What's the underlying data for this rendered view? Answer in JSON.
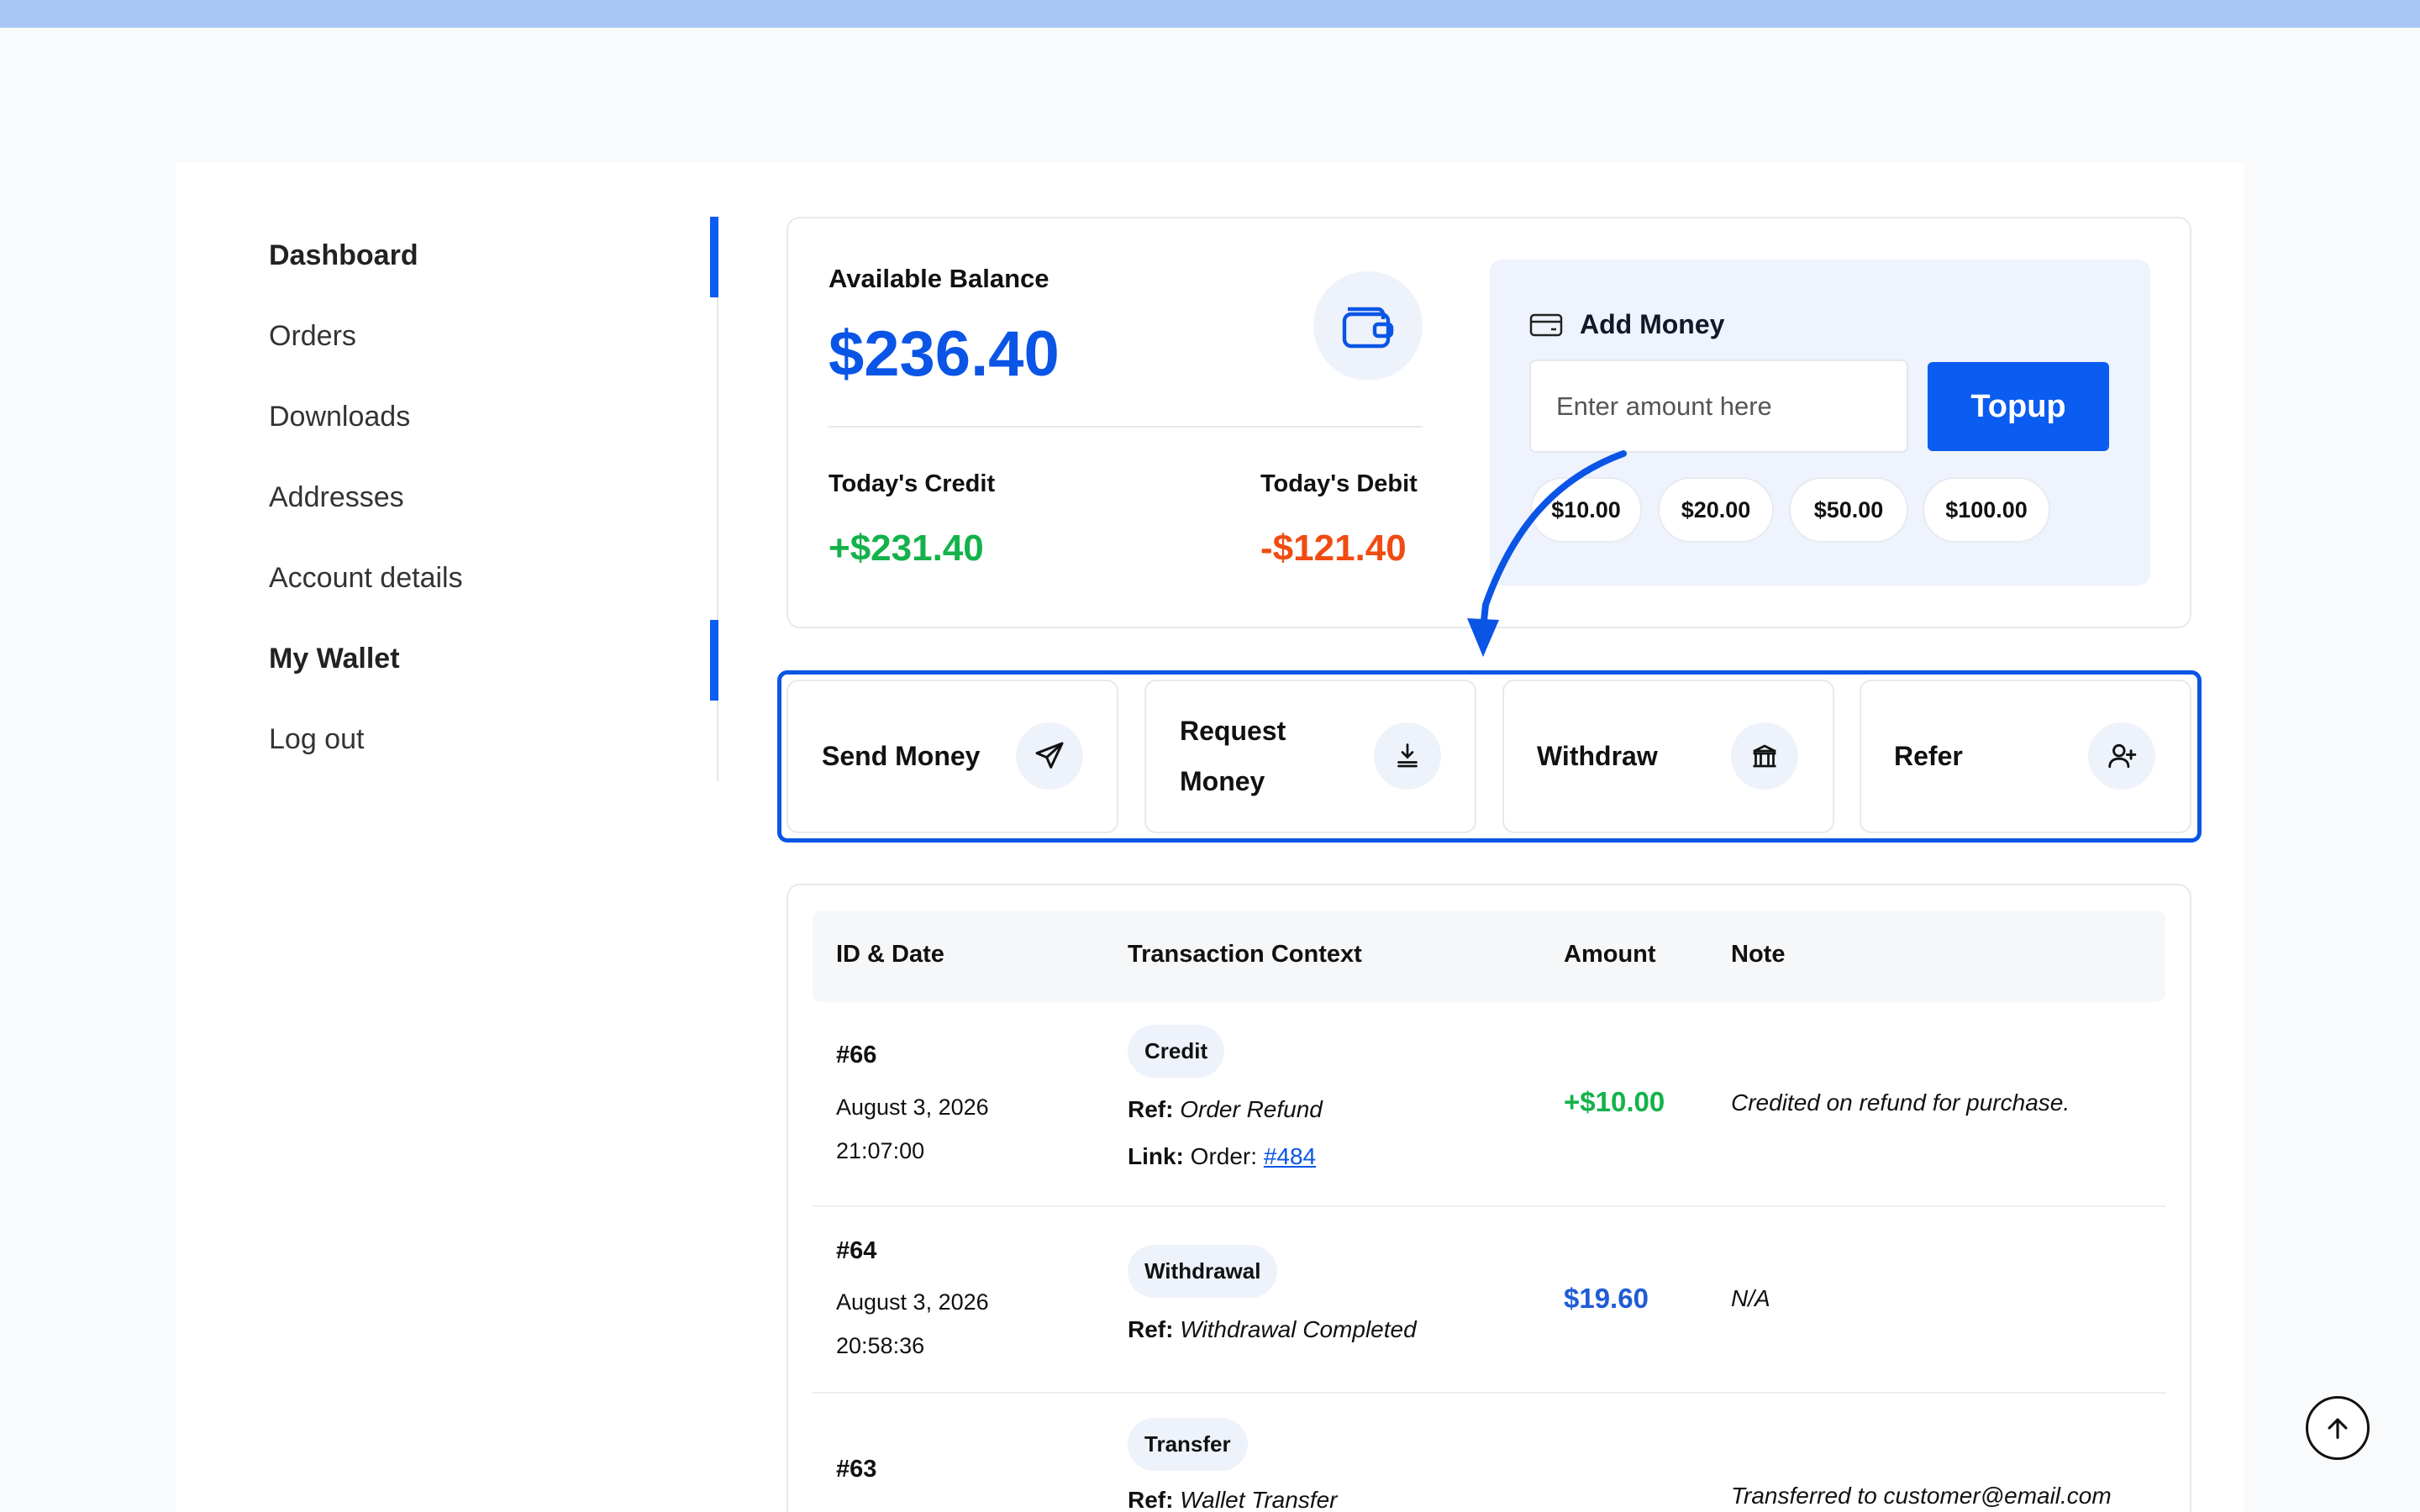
{
  "sidebar": {
    "items": [
      {
        "label": "Dashboard"
      },
      {
        "label": "Orders"
      },
      {
        "label": "Downloads"
      },
      {
        "label": "Addresses"
      },
      {
        "label": "Account details"
      },
      {
        "label": "My Wallet"
      },
      {
        "label": "Log out"
      }
    ]
  },
  "balance": {
    "label": "Available Balance",
    "value": "$236.40",
    "credit_label": "Today's Credit",
    "credit_value": "+$231.40",
    "debit_label": "Today's Debit",
    "debit_value": "-$121.40"
  },
  "add_money": {
    "title": "Add Money",
    "placeholder": "Enter amount here",
    "button": "Topup",
    "presets": [
      "$10.00",
      "$20.00",
      "$50.00",
      "$100.00"
    ]
  },
  "actions": [
    {
      "label": "Send Money",
      "icon": "send-icon"
    },
    {
      "label": "Request Money",
      "icon": "download-icon"
    },
    {
      "label": "Withdraw",
      "icon": "bank-icon"
    },
    {
      "label": "Refer",
      "icon": "user-plus-icon"
    }
  ],
  "transactions": {
    "headers": [
      "ID & Date",
      "Transaction Context",
      "Amount",
      "Note"
    ],
    "rows": [
      {
        "id": "#66",
        "date": "August 3, 2026",
        "time": "21:07:00",
        "type": "Credit",
        "ref_label": "Ref:",
        "ref": "Order Refund",
        "link_label": "Link:",
        "link_prefix": "Order:",
        "link_text": "#484",
        "amount": "+$10.00",
        "note": "Credited on refund for purchase."
      },
      {
        "id": "#64",
        "date": "August 3, 2026",
        "time": "20:58:36",
        "type": "Withdrawal",
        "ref_label": "Ref:",
        "ref": "Withdrawal Completed",
        "amount": "$19.60",
        "note": "N/A"
      },
      {
        "id": "#63",
        "type": "Transfer",
        "ref_label": "Ref:",
        "ref": "Wallet Transfer",
        "note": "Transferred to customer@email.com"
      }
    ]
  },
  "colors": {
    "accent": "#0b5cf0",
    "credit": "#14b24a",
    "debit": "#f04c12"
  }
}
